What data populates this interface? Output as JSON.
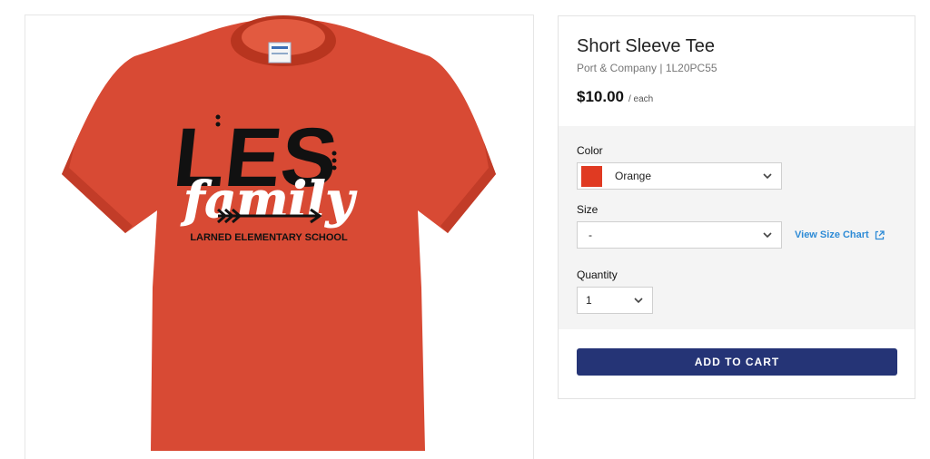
{
  "product": {
    "title": "Short Sleeve Tee",
    "subtitle": "Port & Company | 1L20PC55",
    "price": "$10.00",
    "price_unit": "/ each",
    "image_text": {
      "logo_top": "LES",
      "logo_script": "family",
      "school": "LARNED ELEMENTARY SCHOOL"
    },
    "shirt_color": "#d84a34"
  },
  "options": {
    "color_label": "Color",
    "color_value": "Orange",
    "swatch_color": "#e03a22",
    "size_label": "Size",
    "size_value": "-",
    "size_chart_link": "View Size Chart",
    "quantity_label": "Quantity",
    "quantity_value": "1"
  },
  "cart": {
    "add_label": "ADD TO CART",
    "button_color": "#253476"
  }
}
